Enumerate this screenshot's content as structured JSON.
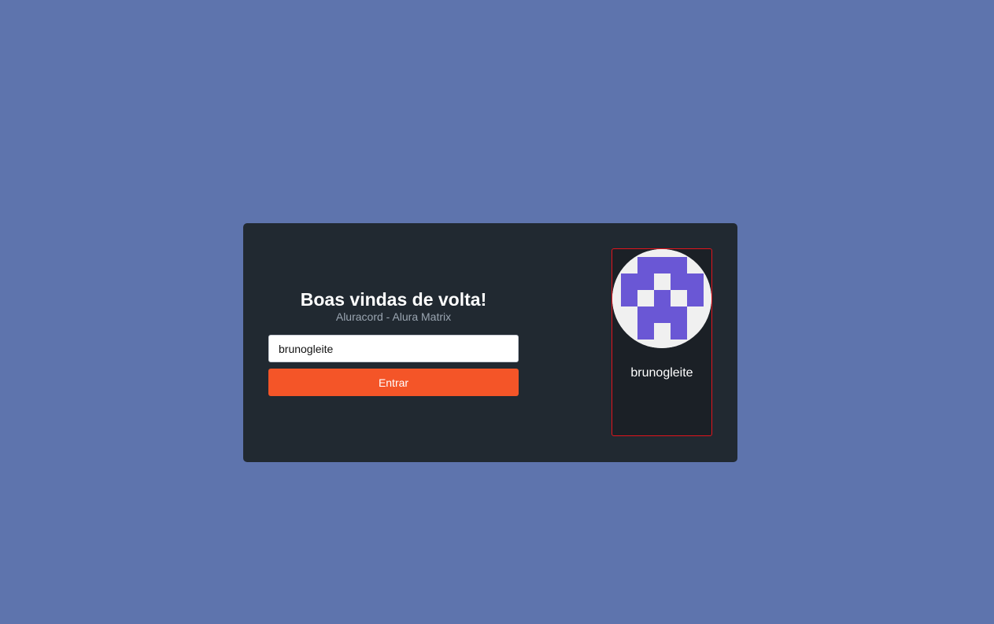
{
  "colors": {
    "page_background": "#5e74ad",
    "card_background": "#212931",
    "accent_button": "#f45528",
    "profile_border": "#e3141c",
    "avatar_pattern": "#6a57d5",
    "avatar_background": "#f0f0f0"
  },
  "login": {
    "title": "Boas vindas de volta!",
    "subtitle": "Aluracord - Alura Matrix",
    "username_value": "brunogleite",
    "submit_label": "Entrar"
  },
  "profile": {
    "avatar_icon": "identicon-avatar",
    "username": "brunogleite"
  }
}
